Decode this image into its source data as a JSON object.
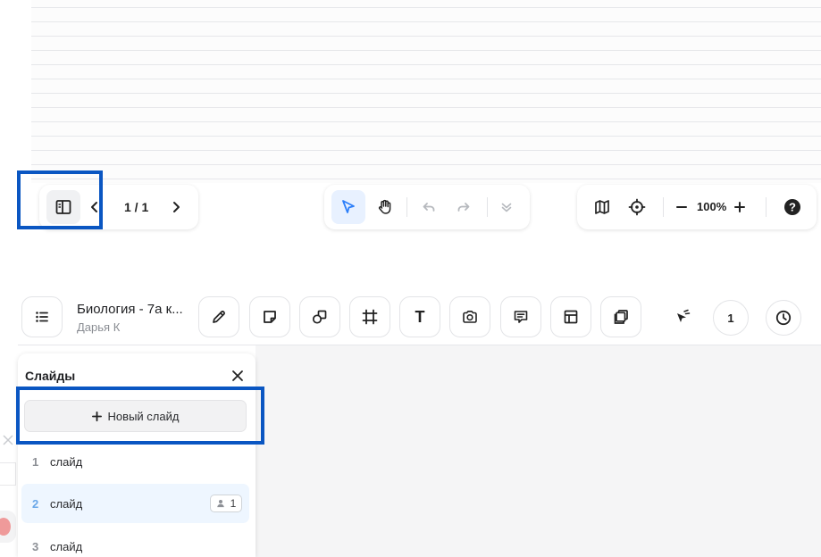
{
  "viewer": {
    "page_indicator": "1 / 1",
    "zoom_level": "100%",
    "icons": {
      "sidebar_toggle": "sidebar-panel-icon",
      "prev_page": "chevron-left-icon",
      "next_page": "chevron-right-icon",
      "select": "cursor-arrow-icon",
      "pan": "hand-icon",
      "undo": "undo-icon",
      "redo": "redo-icon",
      "more": "chevrons-down-icon",
      "map": "map-icon",
      "locate": "crosshair-icon",
      "zoom_out": "minus-icon",
      "zoom_in": "plus-icon",
      "help": "help-icon"
    }
  },
  "editor": {
    "document_title": "Биология - 7а к...",
    "author": "Дарья К",
    "presenter_count": "1",
    "tools": [
      "menu-list-icon",
      "pencil-icon",
      "sticky-note-icon",
      "shapes-icon",
      "frame-icon",
      "text-icon",
      "camera-icon",
      "comment-icon",
      "table-icon",
      "duplicate-icon",
      "laser-pointer-icon",
      "clock-icon"
    ],
    "text_tool_glyph": "T"
  },
  "slides_panel": {
    "title": "Слайды",
    "new_slide_label": "Новый слайд",
    "slides": [
      {
        "number": "1",
        "label": "слайд",
        "current": false
      },
      {
        "number": "2",
        "label": "слайд",
        "current": true,
        "viewers": "1"
      },
      {
        "number": "3",
        "label": "слайд",
        "current": false
      }
    ]
  },
  "colors": {
    "highlight_border": "#0a56c2",
    "accent": "#2d7ff9",
    "current_slide_bg": "#eef6ff"
  }
}
